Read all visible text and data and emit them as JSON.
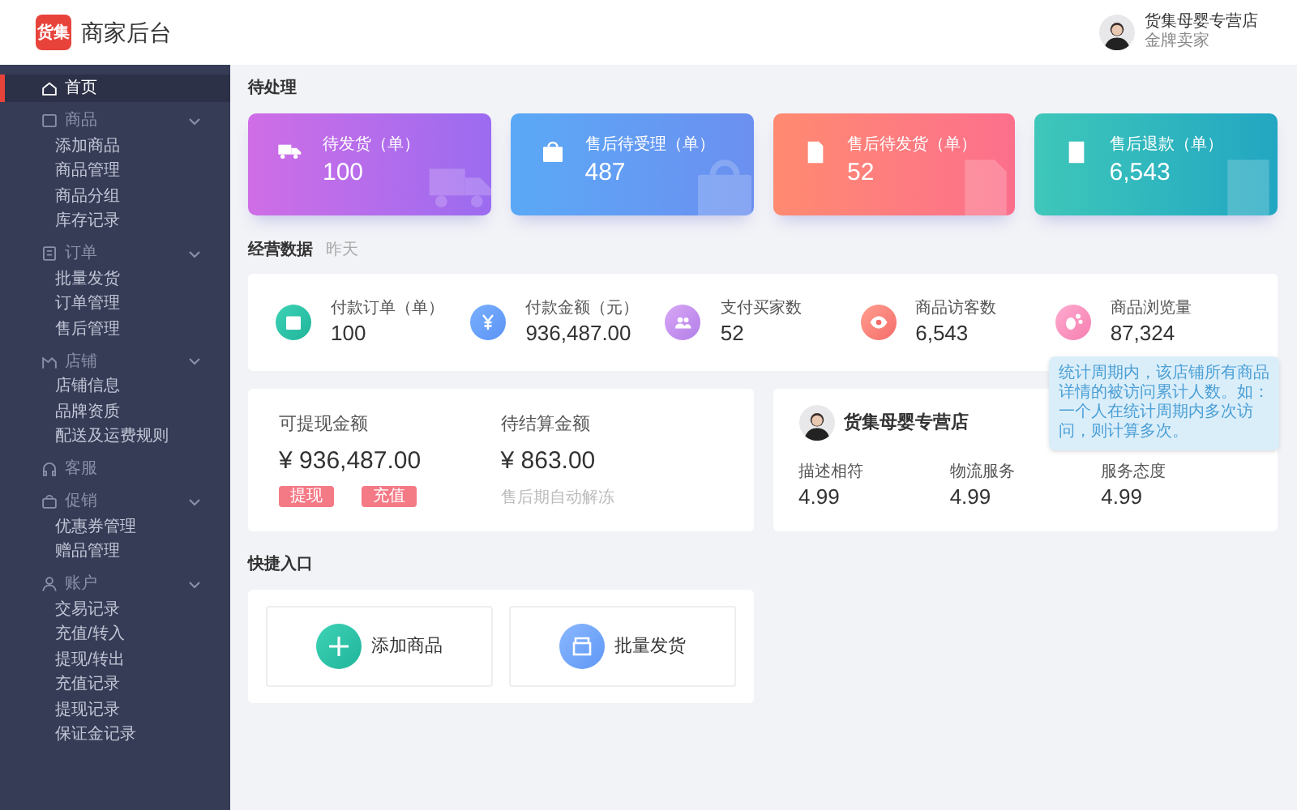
{
  "header": {
    "logo_text": "货集",
    "title": "商家后台",
    "user": {
      "name": "货集母婴专营店",
      "role": "金牌卖家"
    }
  },
  "sidebar": {
    "items": [
      {
        "label": "首页",
        "selected": true
      },
      {
        "label": "商品",
        "selected": false,
        "expanded": true,
        "children": [
          {
            "label": "添加商品"
          },
          {
            "label": "商品管理"
          },
          {
            "label": "商品分组"
          },
          {
            "label": "库存记录"
          }
        ]
      },
      {
        "label": "订单",
        "selected": false,
        "expanded": true,
        "children": [
          {
            "label": "批量发货"
          },
          {
            "label": "订单管理"
          },
          {
            "label": "售后管理"
          }
        ]
      },
      {
        "label": "店铺",
        "selected": false,
        "expanded": true,
        "children": [
          {
            "label": "店铺信息"
          },
          {
            "label": "品牌资质"
          },
          {
            "label": "配送及运费规则"
          }
        ]
      },
      {
        "label": "客服",
        "selected": false
      },
      {
        "label": "促销",
        "selected": false,
        "expanded": true,
        "children": [
          {
            "label": "优惠券管理"
          },
          {
            "label": "赠品管理"
          }
        ]
      },
      {
        "label": "账户",
        "selected": false,
        "expanded": true,
        "children": [
          {
            "label": "交易记录"
          },
          {
            "label": "充值/转入"
          },
          {
            "label": "提现/转出"
          },
          {
            "label": "充值记录"
          },
          {
            "label": "提现记录"
          },
          {
            "label": "保证金记录"
          }
        ]
      }
    ]
  },
  "pending": {
    "title": "待处理",
    "cards": [
      {
        "label": "待发货（单）",
        "value": "100"
      },
      {
        "label": "售后待受理（单）",
        "value": "487"
      },
      {
        "label": "售后待发货（单）",
        "value": "52"
      },
      {
        "label": "售后退款（单）",
        "value": "6,543"
      }
    ]
  },
  "stats": {
    "title": "经营数据",
    "subtitle": "昨天",
    "items": [
      {
        "label": "付款订单（单）",
        "value": "100"
      },
      {
        "label": "付款金额（元）",
        "value": "936,487.00"
      },
      {
        "label": "支付买家数",
        "value": "52"
      },
      {
        "label": "商品访客数",
        "value": "6,543"
      },
      {
        "label": "商品浏览量",
        "value": "87,324"
      }
    ],
    "tooltip": "统计周期内，该店铺所有商品详情的被访问累计人数。如：一个人在统计周期内多次访问，则计算多次。"
  },
  "balance": {
    "items": [
      {
        "label": "可提现金额",
        "value": "¥ 936,487.00",
        "buttons": [
          "提现",
          "充值"
        ]
      },
      {
        "label": "待结算金额",
        "value": "¥ 863.00",
        "note": "售后期自动解冻"
      }
    ]
  },
  "store": {
    "name": "货集母婴专营店",
    "ratings": [
      {
        "label": "描述相符",
        "value": "4.99"
      },
      {
        "label": "物流服务",
        "value": "4.99"
      },
      {
        "label": "服务态度",
        "value": "4.99"
      }
    ]
  },
  "quick": {
    "title": "快捷入口",
    "items": [
      {
        "label": "添加商品"
      },
      {
        "label": "批量发货"
      }
    ]
  }
}
